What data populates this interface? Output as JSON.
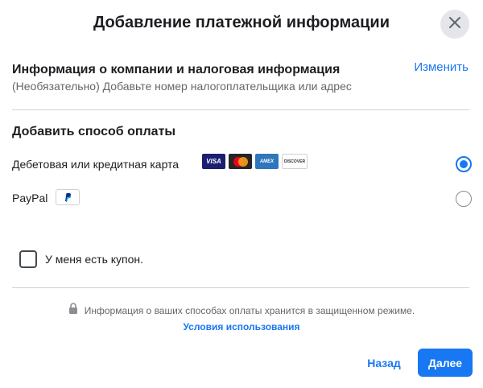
{
  "dialog": {
    "title": "Добавление платежной информации",
    "close_icon": "close-icon"
  },
  "company": {
    "title": "Информация о компании и налоговая информация",
    "subtitle": "(Необязательно) Добавьте номер налогоплательщика или адрес",
    "edit_link": "Изменить"
  },
  "payment": {
    "title": "Добавить способ оплаты",
    "options": [
      {
        "label": "Дебетовая или кредитная карта",
        "selected": true,
        "card_logos": [
          {
            "name": "visa",
            "text": "VISA"
          },
          {
            "name": "mastercard",
            "text": ""
          },
          {
            "name": "amex",
            "text": "AMEX"
          },
          {
            "name": "discover",
            "text": "DISCOVER"
          }
        ]
      },
      {
        "label": "PayPal",
        "selected": false,
        "logo_icon": "paypal-icon"
      }
    ]
  },
  "coupon": {
    "label": "У меня есть купон.",
    "checked": false
  },
  "footer": {
    "secure_icon": "lock-icon",
    "secure_text": "Информация о ваших способах оплаты хранится в защищенном режиме.",
    "terms_link": "Условия использования",
    "back_label": "Назад",
    "next_label": "Далее"
  },
  "colors": {
    "accent": "#1877f2",
    "text_primary": "#1c1e21",
    "text_secondary": "#65676b",
    "divider": "#ced0d4"
  }
}
